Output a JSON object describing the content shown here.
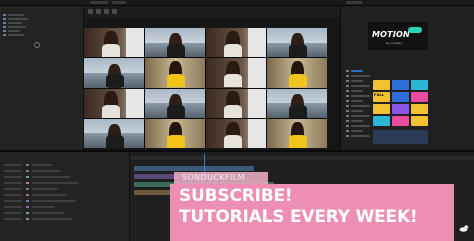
{
  "app": {
    "motion_logo": {
      "word": "MOTION",
      "subtitle": "by d.casey"
    },
    "banner": {
      "channel_name": "SONDUCKFILM",
      "line1": "SUBSCRIBE!",
      "line2": "TUTORIALS EVERY WEEK!"
    },
    "presets": [
      {
        "label": "",
        "color": "#f2c230"
      },
      {
        "label": "",
        "color": "#2f6fdc"
      },
      {
        "label": "",
        "color": "#2bb6d6"
      },
      {
        "label": "FULL",
        "color": "#f2c230"
      },
      {
        "label": "",
        "color": "#2f6fdc"
      },
      {
        "label": "",
        "color": "#e94ba0"
      },
      {
        "label": "",
        "color": "#f2c230"
      },
      {
        "label": "",
        "color": "#8a56e8"
      },
      {
        "label": "",
        "color": "#f2c230"
      },
      {
        "label": "",
        "color": "#2bb6d6"
      },
      {
        "label": "",
        "color": "#e94ba0"
      },
      {
        "label": "",
        "color": "#f2c230"
      }
    ],
    "colors": {
      "accent_blue": "#2e6fbd",
      "banner_pink": "#ec8fb2",
      "motion_teal": "#2bd4b4"
    }
  }
}
